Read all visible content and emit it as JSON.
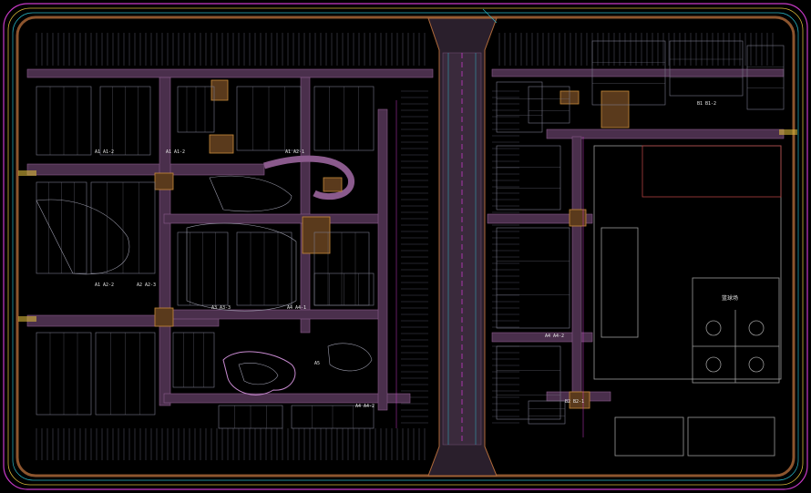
{
  "drawing": {
    "background": "#000000",
    "colors": {
      "road": "#5a3a5c",
      "road_edge": "#b06a3a",
      "paving": "#c88a3a",
      "lot_line": "#3a3a4a",
      "building": "#8a8a9a",
      "boundary_cyan": "#2ab8c8",
      "boundary_magenta": "#c83ac8",
      "boundary_yellow": "#d8b83a",
      "court": "#8a8a8a"
    }
  },
  "labels": {
    "sports_court": "篮球场",
    "zone_1": "A1 A1-2",
    "zone_2": "A1 A1-2",
    "zone_3": "A1 A2-1",
    "zone_4": "A1 A2-2",
    "zone_5": "A2 A2-3",
    "zone_6": "A3 A3-3",
    "zone_7": "A4 A4-1",
    "zone_8": "A5",
    "zone_9": "A4 A4-2",
    "zone_10": "A4 A4-2",
    "zone_11": "B1 B1-2",
    "zone_12": "B2 B2-1"
  }
}
